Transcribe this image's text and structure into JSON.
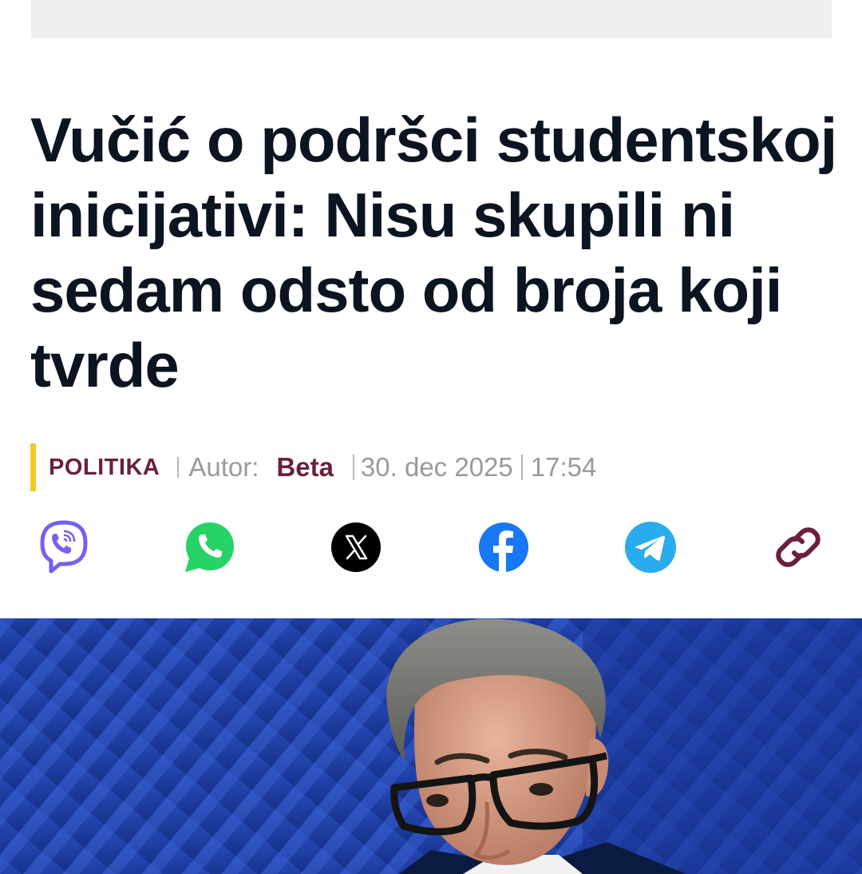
{
  "article": {
    "headline": "Vučić o podršci studentskoj inicijativi: Nisu skupili ni sedam odsto od broja koji tvrde",
    "category": "POLITIKA",
    "author_label": "Autor:",
    "author": "Beta",
    "date": "30. dec 2025",
    "time": "17:54"
  },
  "share": {
    "buttons": [
      {
        "name": "viber",
        "icon": "viber-icon",
        "color": "#7360f2"
      },
      {
        "name": "whatsapp",
        "icon": "whatsapp-icon",
        "color": "#25d366"
      },
      {
        "name": "x",
        "icon": "x-icon",
        "color": "#000000"
      },
      {
        "name": "facebook",
        "icon": "facebook-icon",
        "color": "#1877f2"
      },
      {
        "name": "telegram",
        "icon": "telegram-icon",
        "color": "#2aabee"
      },
      {
        "name": "copy-link",
        "icon": "link-icon",
        "color": "#6b1f3e"
      }
    ]
  },
  "colors": {
    "accent_bar": "#f2c928",
    "category": "#6b1f3e",
    "headline": "#0b1420",
    "meta_gray": "#9a9a9a",
    "hero_bg": "#1e3fa6"
  }
}
